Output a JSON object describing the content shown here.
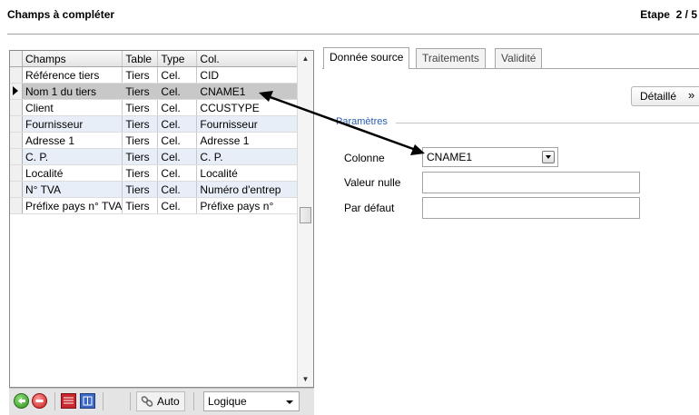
{
  "header": {
    "title": "Champs à compléter",
    "step_label": "Etape",
    "step_value": "2 / 5"
  },
  "grid": {
    "columns": [
      "Champs",
      "Table",
      "Type",
      "Col."
    ],
    "rows": [
      [
        "Référence tiers",
        "Tiers",
        "Cel.",
        "CID"
      ],
      [
        "Nom 1 du tiers",
        "Tiers",
        "Cel.",
        "CNAME1"
      ],
      [
        "Client",
        "Tiers",
        "Cel.",
        "CCUSTYPE"
      ],
      [
        "Fournisseur",
        "Tiers",
        "Cel.",
        "Fournisseur"
      ],
      [
        "Adresse 1",
        "Tiers",
        "Cel.",
        "Adresse 1"
      ],
      [
        "C. P.",
        "Tiers",
        "Cel.",
        "C. P."
      ],
      [
        "Localité",
        "Tiers",
        "Cel.",
        "Localité"
      ],
      [
        "N° TVA",
        "Tiers",
        "Cel.",
        "Numéro d'entrep"
      ],
      [
        "Préfixe pays n° TVA",
        "Tiers",
        "Cel.",
        "Préfixe pays n°"
      ]
    ]
  },
  "toolbar": {
    "auto_label": "Auto",
    "combo_value": "Logique"
  },
  "tabs": [
    "Donnée source",
    "Traitements",
    "Validité"
  ],
  "detail_button": {
    "label": "Détaillé",
    "chevron": "»"
  },
  "group": {
    "label": "Paramètres"
  },
  "form": {
    "colonne_label": "Colonne",
    "colonne_value": "CNAME1",
    "valeur_nulle_label": "Valeur nulle",
    "valeur_nulle_value": "",
    "par_defaut_label": "Par défaut",
    "par_defaut_value": ""
  },
  "colors": {
    "accent": "#2a5db0",
    "selected_row": "#c8c8c8",
    "alt_row": "#e8eef8"
  }
}
